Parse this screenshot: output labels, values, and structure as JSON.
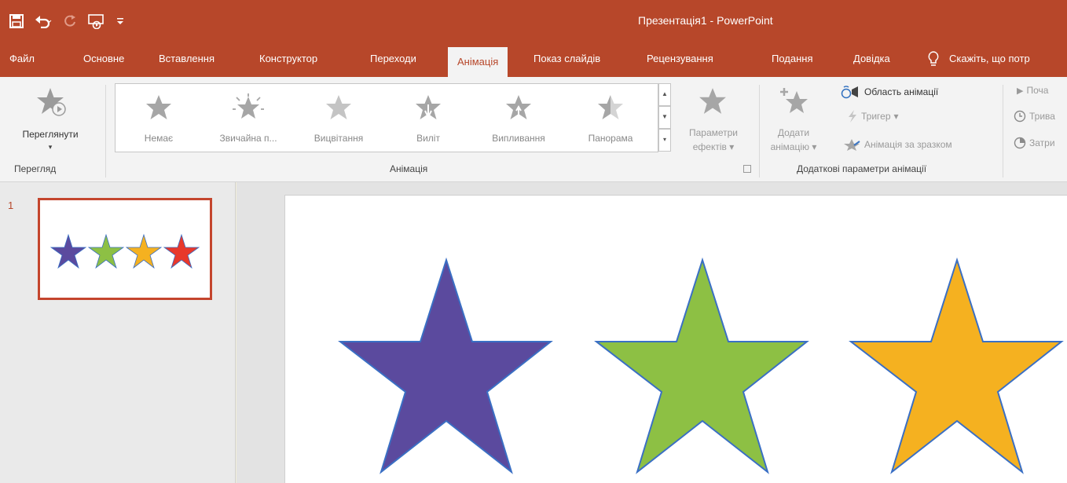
{
  "window": {
    "title": "Презентація1 - PowerPoint"
  },
  "qat": {
    "save_icon": "save-icon",
    "undo_icon": "undo-icon",
    "redo_icon": "redo-icon",
    "start_icon": "start-from-beginning-icon",
    "customize_icon": "customize-qat-icon"
  },
  "tabs": [
    {
      "label": "Файл"
    },
    {
      "label": "Основне"
    },
    {
      "label": "Вставлення"
    },
    {
      "label": "Конструктор"
    },
    {
      "label": "Переходи"
    },
    {
      "label": "Анімація"
    },
    {
      "label": "Показ слайдів"
    },
    {
      "label": "Рецензування"
    },
    {
      "label": "Подання"
    },
    {
      "label": "Довідка"
    }
  ],
  "tell_me": "Скажіть, що потр",
  "ribbon": {
    "preview": {
      "button": "Переглянути",
      "group": "Перегляд"
    },
    "animation": {
      "group": "Анімація",
      "items": [
        {
          "label": "Немає"
        },
        {
          "label": "Звичайна п..."
        },
        {
          "label": "Вицвітання"
        },
        {
          "label": "Виліт"
        },
        {
          "label": "Випливання"
        },
        {
          "label": "Панорама"
        }
      ],
      "effect_options_line1": "Параметри",
      "effect_options_line2": "ефектів"
    },
    "advanced": {
      "group": "Додаткові параметри анімації",
      "add_line1": "Додати",
      "add_line2": "анімацію",
      "pane": "Область анімації",
      "trigger": "Тригер",
      "painter": "Анімація за зразком"
    },
    "timing": {
      "start": "Поча",
      "duration": "Трива",
      "delay": "Затри"
    }
  },
  "slides": {
    "current": "1"
  },
  "colors": {
    "accent": "#b7472a",
    "star_purple": "#5b4a9e",
    "star_green": "#8dc044",
    "star_orange": "#f5b120",
    "star_red": "#e8382b",
    "star_outline": "#3a6fc4"
  }
}
